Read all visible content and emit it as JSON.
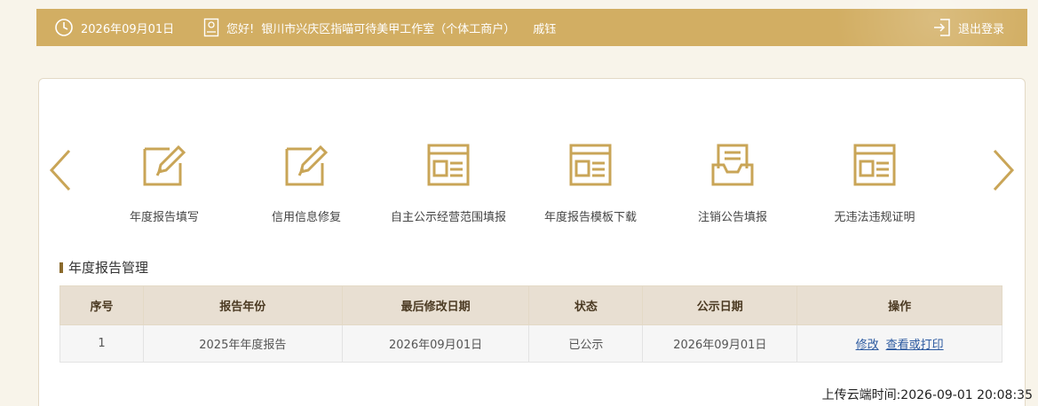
{
  "header": {
    "date": "2026年09月01日",
    "greeting": "您好!",
    "company": "银川市兴庆区指喵可待美甲工作室（个体工商户）",
    "user": "戚钰",
    "logout_label": "退出登录",
    "icons": [
      "clock-icon",
      "id-card-icon",
      "logout-icon"
    ]
  },
  "nav": {
    "items": [
      {
        "label": "年度报告填写",
        "icon": "edit-form-icon"
      },
      {
        "label": "信用信息修复",
        "icon": "edit-form-icon"
      },
      {
        "label": "自主公示经营范围填报",
        "icon": "document-window-icon"
      },
      {
        "label": "年度报告模板下载",
        "icon": "document-window-icon"
      },
      {
        "label": "注销公告填报",
        "icon": "inbox-document-icon"
      },
      {
        "label": "无违法违规证明",
        "icon": "document-window-icon"
      }
    ]
  },
  "section": {
    "title": "年度报告管理"
  },
  "table": {
    "headers": [
      "序号",
      "报告年份",
      "最后修改日期",
      "状态",
      "公示日期",
      "操作"
    ],
    "rows": [
      {
        "index": "1",
        "year": "2025年年度报告",
        "modified": "2026年09月01日",
        "status": "已公示",
        "publish_date": "2026年09月01日",
        "actions": [
          "修改",
          "查看或打印"
        ]
      }
    ]
  },
  "footer": {
    "upload_time": "上传云端时间:2026-09-01 20:08:35"
  },
  "colors": {
    "gold": "#d2ae63",
    "icon_gold": "#c9a557",
    "link": "#2c5aa0"
  }
}
